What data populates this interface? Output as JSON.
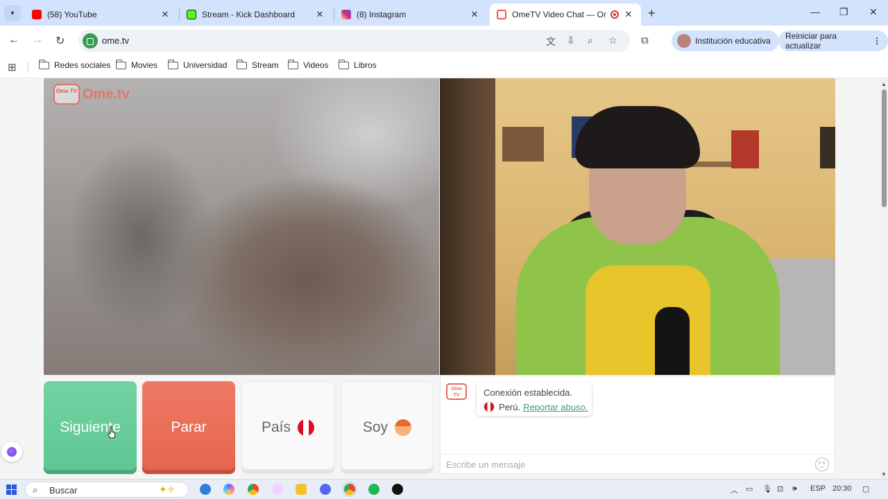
{
  "browser": {
    "tabs": [
      {
        "title": "(58) YouTube",
        "icon": "youtube-icon",
        "color": "#ff0000",
        "active": false
      },
      {
        "title": "Stream - Kick Dashboard",
        "icon": "kick-icon",
        "color": "#1e1e1e",
        "active": false
      },
      {
        "title": "(8) Instagram",
        "icon": "instagram-icon",
        "color": "#d6249f",
        "active": false
      },
      {
        "title": "OmeTV Video Chat — Ome",
        "icon": "ometv-icon",
        "color": "#e25a4a",
        "active": true
      }
    ],
    "url": "ome.tv",
    "profile_label": "Institución educativa",
    "update_label": "Reiniciar para actualizar"
  },
  "bookmarks": [
    "Redes sociales",
    "Movies",
    "Universidad",
    "Stream",
    "Videos",
    "Libros"
  ],
  "ometv": {
    "logo_text": "Ome.tv",
    "logo_badge": "Ome TV",
    "buttons": {
      "next": "Siguiente",
      "stop": "Parar",
      "country": "País",
      "gender": "Soy"
    },
    "chat": {
      "status": "Conexión establecida.",
      "country": "Perú.",
      "report_link": "Reportar abuso.",
      "input_placeholder": "Escribe un mensaje"
    },
    "colors": {
      "next": "#5ec692",
      "stop": "#e6644e",
      "link": "#3f9a79"
    }
  },
  "taskbar": {
    "search_placeholder": "Buscar",
    "language": "ESP",
    "time": "20:30"
  }
}
